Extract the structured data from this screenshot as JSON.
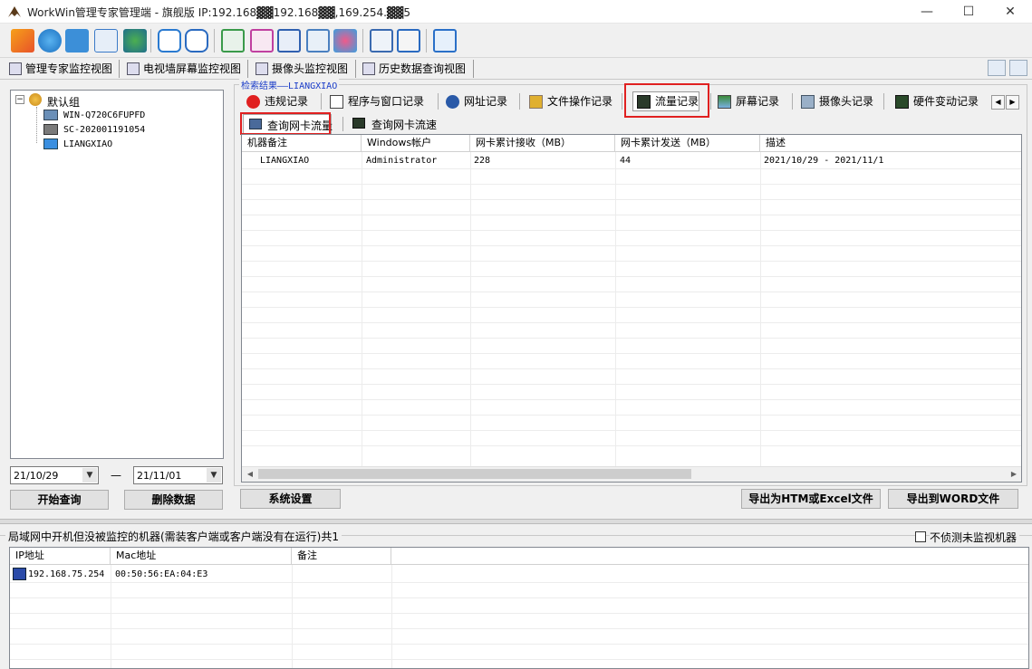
{
  "window": {
    "title": "WorkWin管理专家管理端 - 旗舰版 IP:192.168▓▓192.168▓▓,169.254.▓▓5",
    "minimize": "—",
    "maximize": "☐",
    "close": "✕"
  },
  "views": [
    {
      "label": "管理专家监控视图"
    },
    {
      "label": "电视墙屏幕监控视图"
    },
    {
      "label": "摄像头监控视图"
    },
    {
      "label": "历史数据查询视图"
    }
  ],
  "tree": {
    "root": "默认组",
    "expander": "−",
    "computers": [
      "WIN-Q720C6FUPFD",
      "SC-202001191054",
      "LIANGXIAO"
    ]
  },
  "date_range": {
    "start": "21/10/29",
    "separator": "—",
    "end": "21/11/01"
  },
  "left_buttons": {
    "query": "开始查询",
    "delete": "删除数据"
  },
  "results": {
    "group_title": "检索结果——LIANGXIAO",
    "tabs": [
      {
        "label": "违规记录"
      },
      {
        "label": "程序与窗口记录"
      },
      {
        "label": "网址记录"
      },
      {
        "label": "文件操作记录"
      },
      {
        "label": "流量记录"
      },
      {
        "label": "屏幕记录"
      },
      {
        "label": "摄像头记录"
      },
      {
        "label": "硬件变动记录"
      }
    ],
    "scroll_left": "◀",
    "scroll_right": "▶",
    "subtabs": [
      {
        "label": "查询网卡流量"
      },
      {
        "label": "查询网卡流速"
      }
    ],
    "columns": [
      "机器备注",
      "Windows帐户",
      "网卡累计接收（MB）",
      "网卡累计发送（MB）",
      "描述"
    ],
    "rows": [
      [
        "LIANGXIAO",
        "Administrator",
        "228",
        "44",
        "2021/10/29 - 2021/11/1"
      ]
    ],
    "hscroll_left": "◀",
    "hscroll_right": "▶"
  },
  "bottom_buttons": {
    "settings": "系统设置",
    "export_html": "导出为HTM或Excel文件",
    "export_word": "导出到WORD文件"
  },
  "unmonitored": {
    "title": "局域网中开机但没被监控的机器(需装客户端或客户端没有在运行)共1",
    "checkbox_label": "不侦测未监视机器",
    "columns": [
      "IP地址",
      "Mac地址",
      "备注"
    ],
    "rows": [
      [
        "192.168.75.254",
        "00:50:56:EA:04:E3",
        ""
      ]
    ]
  }
}
